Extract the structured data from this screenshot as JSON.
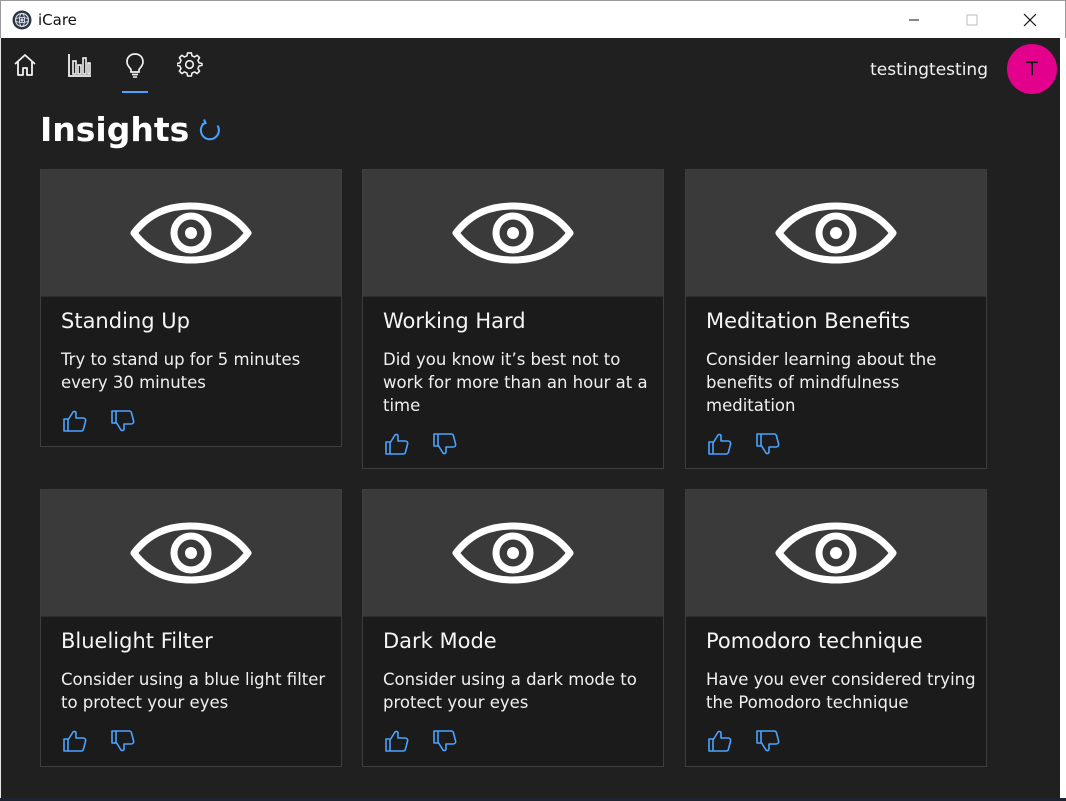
{
  "window": {
    "title": "iCare"
  },
  "nav": {
    "items": [
      {
        "name": "home",
        "icon": "home-icon"
      },
      {
        "name": "statistics",
        "icon": "bar-chart-icon"
      },
      {
        "name": "insights",
        "icon": "lightbulb-icon",
        "active": true
      },
      {
        "name": "settings",
        "icon": "gear-icon"
      }
    ],
    "username": "testingtesting",
    "avatar_initial": "T",
    "accent_color": "#4aa3ff",
    "avatar_color": "#e3008c"
  },
  "page": {
    "title": "Insights"
  },
  "cards": [
    {
      "title": "Standing Up",
      "description": "Try to stand up for 5 minutes every 30 minutes",
      "icon": "eye-icon"
    },
    {
      "title": "Working Hard",
      "description": "Did you know it’s best not to work for more than an hour at a time",
      "icon": "eye-icon"
    },
    {
      "title": "Meditation Benefits",
      "description": "Consider learning about the benefits of mindfulness meditation",
      "icon": "eye-icon"
    },
    {
      "title": "Bluelight Filter",
      "description": "Consider using a blue light filter to protect your eyes",
      "icon": "eye-icon"
    },
    {
      "title": "Dark Mode",
      "description": "Consider using a dark mode to protect your eyes",
      "icon": "eye-icon"
    },
    {
      "title": "Pomodoro technique",
      "description": "Have you ever considered trying the Pomodoro technique",
      "icon": "eye-icon"
    }
  ]
}
